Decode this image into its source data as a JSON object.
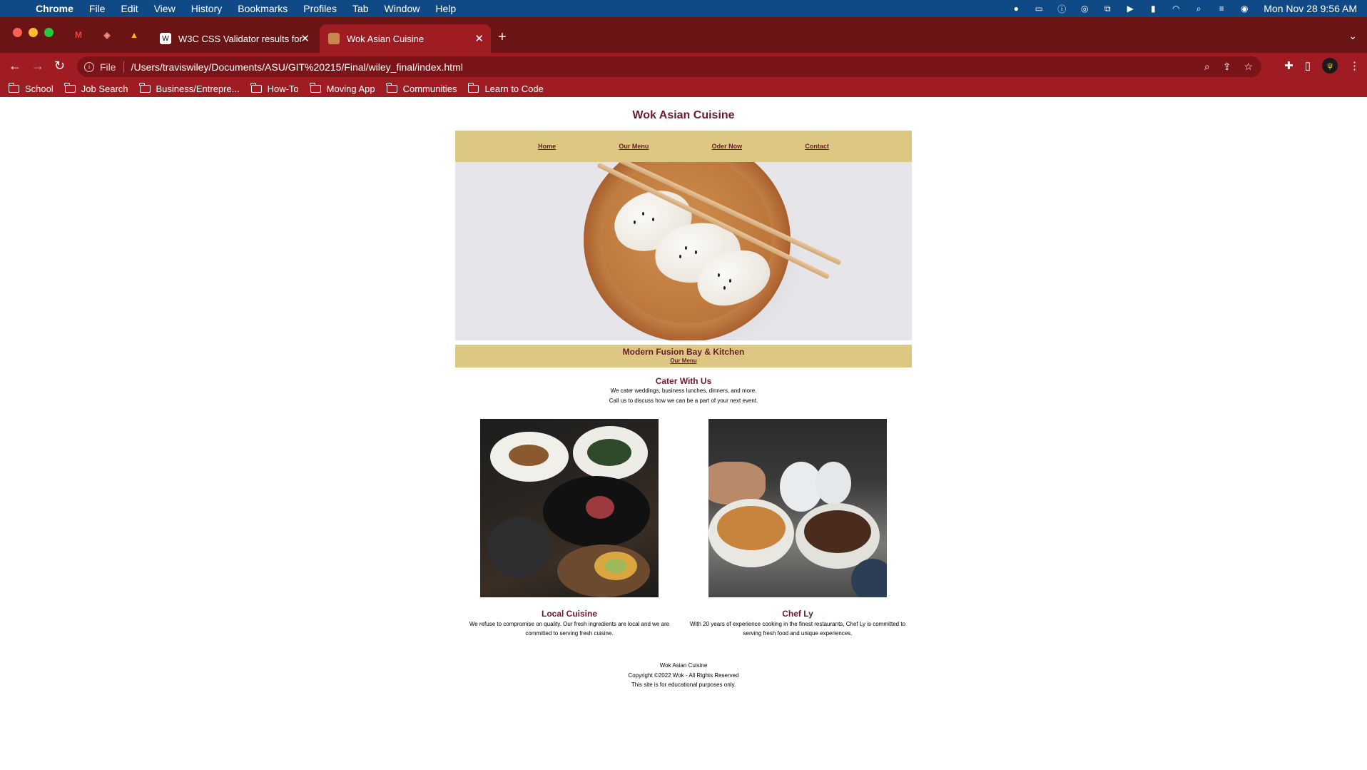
{
  "menubar": {
    "app_name": "Chrome",
    "items": [
      "File",
      "Edit",
      "View",
      "History",
      "Bookmarks",
      "Profiles",
      "Tab",
      "Window",
      "Help"
    ],
    "clock": "Mon Nov 28  9:56 AM"
  },
  "tabs": {
    "inactive_title": "W3C CSS Validator results for",
    "active_title": "Wok Asian Cuisine"
  },
  "address_bar": {
    "scheme_label": "File",
    "url": "/Users/traviswiley/Documents/ASU/GIT%20215/Final/wiley_final/index.html"
  },
  "bookmarks": [
    "School",
    "Job Search",
    "Business/Entrepre...",
    "How-To",
    "Moving App",
    "Communities",
    "Learn to Code"
  ],
  "site": {
    "title": "Wok Asian Cuisine",
    "nav": [
      "Home",
      "Our Menu",
      "Oder Now",
      "Contact"
    ],
    "tagline": "Modern Fusion Bay & Kitchen",
    "tagline_link": "Our Menu",
    "cater": {
      "heading": "Cater With Us",
      "line1": "We cater weddings, business lunches, dinners, and more.",
      "line2": "Call us to discuss how we can be a part of your next event."
    },
    "cards": [
      {
        "heading": "Local Cuisine",
        "text": "We refuse to compromise on quality. Our fresh ingredients are local and we are committed to serving fresh cuisine."
      },
      {
        "heading": "Chef Ly",
        "text": "With 20 years of experience cooking in the finest restaurants, Chef Ly is committed to serving fresh food and unique experiences."
      }
    ],
    "footer": {
      "line1": "Wok Asian Cuisine",
      "line2": "Copyright ©2022 Wok - All Rights Reserved",
      "line3": "This site is for educational purposes only."
    }
  }
}
